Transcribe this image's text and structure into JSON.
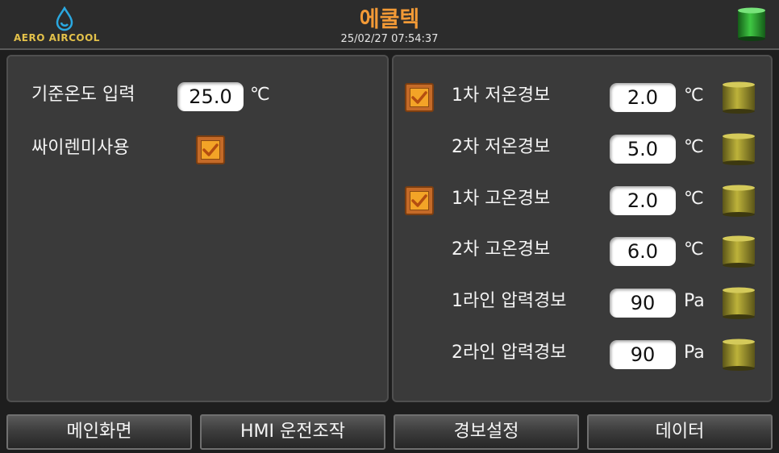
{
  "header": {
    "logo_text": "AERO AIRCOOL",
    "title": "에쿨텍",
    "datetime": "25/02/27 07:54:37"
  },
  "left_panel": {
    "setpoint": {
      "label": "기준온도 입력",
      "value": "25.0",
      "unit": "℃"
    },
    "siren": {
      "label": "싸이렌미사용",
      "checked": true
    }
  },
  "right_panel": {
    "alarms": [
      {
        "label": "1차 저온경보",
        "value": "2.0",
        "unit": "℃",
        "checked": true
      },
      {
        "label": "2차 저온경보",
        "value": "5.0",
        "unit": "℃",
        "checked": false
      },
      {
        "label": "1차 고온경보",
        "value": "2.0",
        "unit": "℃",
        "checked": true
      },
      {
        "label": "2차 고온경보",
        "value": "6.0",
        "unit": "℃",
        "checked": false
      },
      {
        "label": "1라인 압력경보",
        "value": "90",
        "unit": "Pa",
        "checked": false
      },
      {
        "label": "2라인 압력경보",
        "value": "90",
        "unit": "Pa",
        "checked": false
      }
    ]
  },
  "nav": {
    "main": "메인화면",
    "hmi": "HMI 운전조작",
    "alarm_settings": "경보설정",
    "data": "데이터"
  },
  "colors": {
    "title": "#f39a36",
    "checkbox": "#f3a427",
    "status_lamp": "#2fa534",
    "alarm_lamp": "#a39a2e"
  },
  "icons": {
    "logo": "water-drop-icon",
    "status": "green-lamp-icon",
    "alarm": "olive-lamp-icon",
    "check": "check-icon"
  }
}
